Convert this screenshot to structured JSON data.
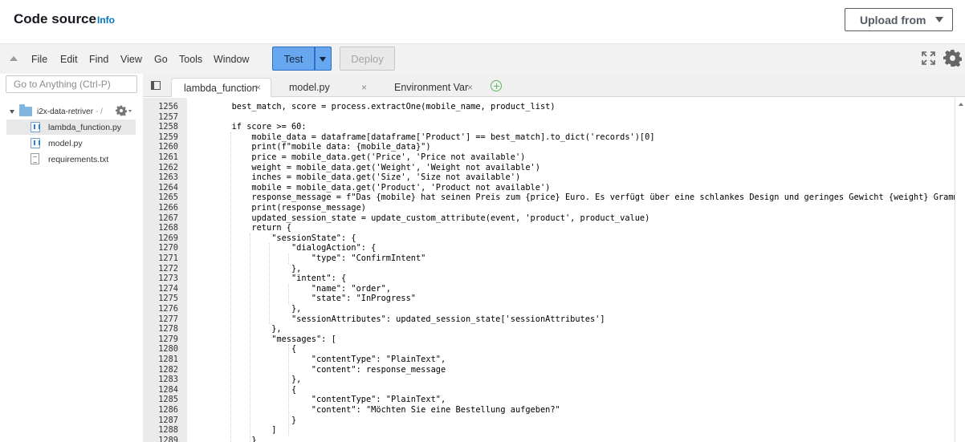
{
  "header": {
    "title": "Code source",
    "info": "Info",
    "upload_from": "Upload from"
  },
  "menu": {
    "items": [
      "File",
      "Edit",
      "Find",
      "View",
      "Go",
      "Tools",
      "Window"
    ],
    "test": "Test",
    "deploy": "Deploy"
  },
  "sidebar": {
    "goto_placeholder": "Go to Anything (Ctrl-P)",
    "folder": "i2x-data-retriver",
    "folder_suffix": "- /",
    "files": [
      "lambda_function.py",
      "model.py",
      "requirements.txt"
    ]
  },
  "tabs": [
    {
      "label": "lambda_function",
      "active": true
    },
    {
      "label": "model.py",
      "active": false
    },
    {
      "label": "Environment Var",
      "active": false
    }
  ],
  "editor": {
    "lines": [
      {
        "n": "1256",
        "code": "        best_match, score = process.extractOne(mobile_name, product_list)"
      },
      {
        "n": "1257",
        "code": ""
      },
      {
        "n": "1258",
        "code": "        if score >= 60:"
      },
      {
        "n": "1259",
        "code": "            mobile_data = dataframe[dataframe['Product'] == best_match].to_dict('records')[0]"
      },
      {
        "n": "1260",
        "code": "            print(f\"mobile data: {mobile_data}\")"
      },
      {
        "n": "1261",
        "code": "            price = mobile_data.get('Price', 'Price not available')"
      },
      {
        "n": "1262",
        "code": "            weight = mobile_data.get('Weight', 'Weight not available')"
      },
      {
        "n": "1263",
        "code": "            inches = mobile_data.get('Size', 'Size not available')"
      },
      {
        "n": "1264",
        "code": "            mobile = mobile_data.get('Product', 'Product not available')"
      },
      {
        "n": "1265",
        "code": "            response_message = f\"Das {mobile} hat seinen Preis zum {price} Euro. Es verfügt über eine schlankes Design und geringes Gewicht {weight} Gramm, was es"
      },
      {
        "n": "1266",
        "code": "            print(response_message)"
      },
      {
        "n": "1267",
        "code": "            updated_session_state = update_custom_attribute(event, 'product', product_value)"
      },
      {
        "n": "1268",
        "code": "            return {"
      },
      {
        "n": "1269",
        "code": "                \"sessionState\": {"
      },
      {
        "n": "1270",
        "code": "                    \"dialogAction\": {"
      },
      {
        "n": "1271",
        "code": "                        \"type\": \"ConfirmIntent\""
      },
      {
        "n": "1272",
        "code": "                    },"
      },
      {
        "n": "1273",
        "code": "                    \"intent\": {"
      },
      {
        "n": "1274",
        "code": "                        \"name\": \"order\","
      },
      {
        "n": "1275",
        "code": "                        \"state\": \"InProgress\""
      },
      {
        "n": "1276",
        "code": "                    },"
      },
      {
        "n": "1277",
        "code": "                    \"sessionAttributes\": updated_session_state['sessionAttributes']"
      },
      {
        "n": "1278",
        "code": "                },"
      },
      {
        "n": "1279",
        "code": "                \"messages\": ["
      },
      {
        "n": "1280",
        "code": "                    {"
      },
      {
        "n": "1281",
        "code": "                        \"contentType\": \"PlainText\","
      },
      {
        "n": "1282",
        "code": "                        \"content\": response_message"
      },
      {
        "n": "1283",
        "code": "                    },"
      },
      {
        "n": "1284",
        "code": "                    {"
      },
      {
        "n": "1285",
        "code": "                        \"contentType\": \"PlainText\","
      },
      {
        "n": "1286",
        "code": "                        \"content\": \"Möchten Sie eine Bestellung aufgeben?\""
      },
      {
        "n": "1287",
        "code": "                    }"
      },
      {
        "n": "1288",
        "code": "                ]"
      },
      {
        "n": "1289",
        "code": "            }"
      }
    ]
  }
}
